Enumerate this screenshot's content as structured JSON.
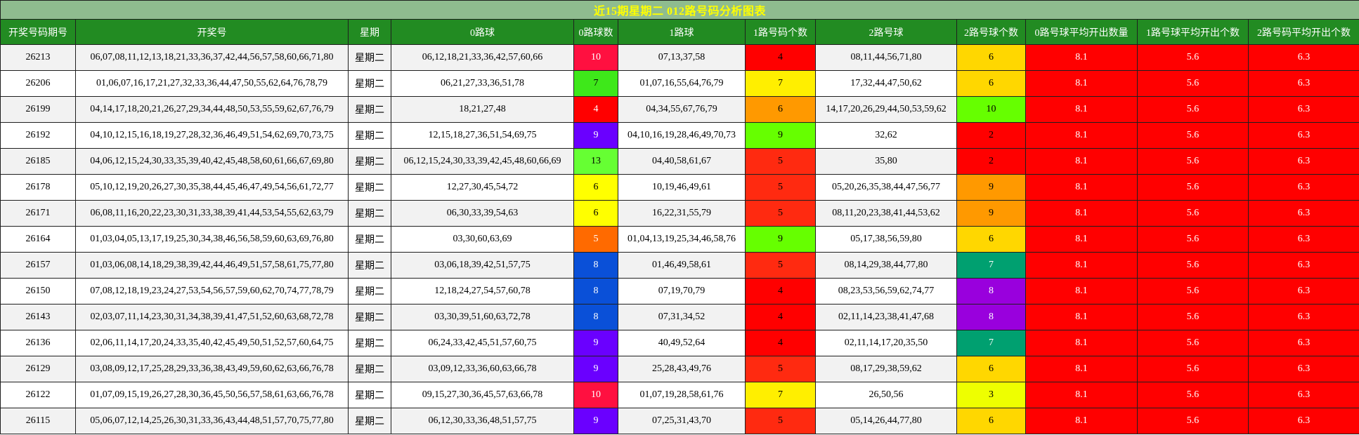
{
  "page_title": "近15期星期二 012路号码分析图表",
  "colors": {
    "title_bg": "#8fbc8f",
    "title_fg": "#ffff00",
    "header_bg": "#228b22",
    "header_fg": "#ffffff",
    "avg_bg": "#ff0000",
    "row_even_bg": "#f2f2f2",
    "row_odd_bg": "#ffffff"
  },
  "chart_data": {
    "type": "table",
    "title": "近15期星期二 012路号码分析图表",
    "columns": [
      "开奖号码期号",
      "开奖号",
      "星期",
      "0路球",
      "0路球数",
      "1路球",
      "1路号码个数",
      "2路号球",
      "2路号球个数",
      "0路号球平均开出数量",
      "1路号球平均开出个数",
      "2路号码平均开出个数"
    ],
    "rows": [
      {
        "issue": "26213",
        "numbers": "06,07,08,11,12,13,18,21,33,36,37,42,44,56,57,58,60,66,71,80",
        "weekday": "星期二",
        "r0": "06,12,18,21,33,36,42,57,60,66",
        "c0": "10",
        "r1": "07,13,37,58",
        "c1": "4",
        "r2": "08,11,44,56,71,80",
        "c2": "6",
        "a0": "8.1",
        "a1": "5.6",
        "a2": "6.3",
        "c0_color": "#ff1040",
        "c1_color": "#ff0000",
        "c2_color": "#ffd700"
      },
      {
        "issue": "26206",
        "numbers": "01,06,07,16,17,21,27,32,33,36,44,47,50,55,62,64,76,78,79",
        "weekday": "星期二",
        "r0": "06,21,27,33,36,51,78",
        "c0": "7",
        "r1": "01,07,16,55,64,76,79",
        "c1": "7",
        "r2": "17,32,44,47,50,62",
        "c2": "6",
        "a0": "8.1",
        "a1": "5.6",
        "a2": "6.3",
        "c0_color": "#3ee81a",
        "c1_color": "#ffef00",
        "c2_color": "#ffd700"
      },
      {
        "issue": "26199",
        "numbers": "04,14,17,18,20,21,26,27,29,34,44,48,50,53,55,59,62,67,76,79",
        "weekday": "星期二",
        "r0": "18,21,27,48",
        "c0": "4",
        "r1": "04,34,55,67,76,79",
        "c1": "6",
        "r2": "14,17,20,26,29,44,50,53,59,62",
        "c2": "10",
        "a0": "8.1",
        "a1": "5.6",
        "a2": "6.3",
        "c0_color": "#ff0000",
        "c1_color": "#ff9900",
        "c2_color": "#66ff00"
      },
      {
        "issue": "26192",
        "numbers": "04,10,12,15,16,18,19,27,28,32,36,46,49,51,54,62,69,70,73,75",
        "weekday": "星期二",
        "r0": "12,15,18,27,36,51,54,69,75",
        "c0": "9",
        "r1": "04,10,16,19,28,46,49,70,73",
        "c1": "9",
        "r2": "32,62",
        "c2": "2",
        "a0": "8.1",
        "a1": "5.6",
        "a2": "6.3",
        "c0_color": "#6a00ff",
        "c1_color": "#66ff00",
        "c2_color": "#ff0000"
      },
      {
        "issue": "26185",
        "numbers": "04,06,12,15,24,30,33,35,39,40,42,45,48,58,60,61,66,67,69,80",
        "weekday": "星期二",
        "r0": "06,12,15,24,30,33,39,42,45,48,60,66,69",
        "c0": "13",
        "r1": "04,40,58,61,67",
        "c1": "5",
        "r2": "35,80",
        "c2": "2",
        "a0": "8.1",
        "a1": "5.6",
        "a2": "6.3",
        "c0_color": "#66ff33",
        "c1_color": "#ff2a10",
        "c2_color": "#ff0000"
      },
      {
        "issue": "26178",
        "numbers": "05,10,12,19,20,26,27,30,35,38,44,45,46,47,49,54,56,61,72,77",
        "weekday": "星期二",
        "r0": "12,27,30,45,54,72",
        "c0": "6",
        "r1": "10,19,46,49,61",
        "c1": "5",
        "r2": "05,20,26,35,38,44,47,56,77",
        "c2": "9",
        "a0": "8.1",
        "a1": "5.6",
        "a2": "6.3",
        "c0_color": "#ffff00",
        "c1_color": "#ff2a10",
        "c2_color": "#ff9900"
      },
      {
        "issue": "26171",
        "numbers": "06,08,11,16,20,22,23,30,31,33,38,39,41,44,53,54,55,62,63,79",
        "weekday": "星期二",
        "r0": "06,30,33,39,54,63",
        "c0": "6",
        "r1": "16,22,31,55,79",
        "c1": "5",
        "r2": "08,11,20,23,38,41,44,53,62",
        "c2": "9",
        "a0": "8.1",
        "a1": "5.6",
        "a2": "6.3",
        "c0_color": "#ffff00",
        "c1_color": "#ff2a10",
        "c2_color": "#ff9900"
      },
      {
        "issue": "26164",
        "numbers": "01,03,04,05,13,17,19,25,30,34,38,46,56,58,59,60,63,69,76,80",
        "weekday": "星期二",
        "r0": "03,30,60,63,69",
        "c0": "5",
        "r1": "01,04,13,19,25,34,46,58,76",
        "c1": "9",
        "r2": "05,17,38,56,59,80",
        "c2": "6",
        "a0": "8.1",
        "a1": "5.6",
        "a2": "6.3",
        "c0_color": "#ff6a00",
        "c1_color": "#66ff00",
        "c2_color": "#ffd700"
      },
      {
        "issue": "26157",
        "numbers": "01,03,06,08,14,18,29,38,39,42,44,46,49,51,57,58,61,75,77,80",
        "weekday": "星期二",
        "r0": "03,06,18,39,42,51,57,75",
        "c0": "8",
        "r1": "01,46,49,58,61",
        "c1": "5",
        "r2": "08,14,29,38,44,77,80",
        "c2": "7",
        "a0": "8.1",
        "a1": "5.6",
        "a2": "6.3",
        "c0_color": "#0a50d8",
        "c1_color": "#ff2a10",
        "c2_color": "#00a070"
      },
      {
        "issue": "26150",
        "numbers": "07,08,12,18,19,23,24,27,53,54,56,57,59,60,62,70,74,77,78,79",
        "weekday": "星期二",
        "r0": "12,18,24,27,54,57,60,78",
        "c0": "8",
        "r1": "07,19,70,79",
        "c1": "4",
        "r2": "08,23,53,56,59,62,74,77",
        "c2": "8",
        "a0": "8.1",
        "a1": "5.6",
        "a2": "6.3",
        "c0_color": "#0a50d8",
        "c1_color": "#ff0000",
        "c2_color": "#9900dd"
      },
      {
        "issue": "26143",
        "numbers": "02,03,07,11,14,23,30,31,34,38,39,41,47,51,52,60,63,68,72,78",
        "weekday": "星期二",
        "r0": "03,30,39,51,60,63,72,78",
        "c0": "8",
        "r1": "07,31,34,52",
        "c1": "4",
        "r2": "02,11,14,23,38,41,47,68",
        "c2": "8",
        "a0": "8.1",
        "a1": "5.6",
        "a2": "6.3",
        "c0_color": "#0a50d8",
        "c1_color": "#ff0000",
        "c2_color": "#9900dd"
      },
      {
        "issue": "26136",
        "numbers": "02,06,11,14,17,20,24,33,35,40,42,45,49,50,51,52,57,60,64,75",
        "weekday": "星期二",
        "r0": "06,24,33,42,45,51,57,60,75",
        "c0": "9",
        "r1": "40,49,52,64",
        "c1": "4",
        "r2": "02,11,14,17,20,35,50",
        "c2": "7",
        "a0": "8.1",
        "a1": "5.6",
        "a2": "6.3",
        "c0_color": "#6a00ff",
        "c1_color": "#ff0000",
        "c2_color": "#00a070"
      },
      {
        "issue": "26129",
        "numbers": "03,08,09,12,17,25,28,29,33,36,38,43,49,59,60,62,63,66,76,78",
        "weekday": "星期二",
        "r0": "03,09,12,33,36,60,63,66,78",
        "c0": "9",
        "r1": "25,28,43,49,76",
        "c1": "5",
        "r2": "08,17,29,38,59,62",
        "c2": "6",
        "a0": "8.1",
        "a1": "5.6",
        "a2": "6.3",
        "c0_color": "#6a00ff",
        "c1_color": "#ff2a10",
        "c2_color": "#ffd700"
      },
      {
        "issue": "26122",
        "numbers": "01,07,09,15,19,26,27,28,30,36,45,50,56,57,58,61,63,66,76,78",
        "weekday": "星期二",
        "r0": "09,15,27,30,36,45,57,63,66,78",
        "c0": "10",
        "r1": "01,07,19,28,58,61,76",
        "c1": "7",
        "r2": "26,50,56",
        "c2": "3",
        "a0": "8.1",
        "a1": "5.6",
        "a2": "6.3",
        "c0_color": "#ff1040",
        "c1_color": "#ffef00",
        "c2_color": "#eeff00"
      },
      {
        "issue": "26115",
        "numbers": "05,06,07,12,14,25,26,30,31,33,36,43,44,48,51,57,70,75,77,80",
        "weekday": "星期二",
        "r0": "06,12,30,33,36,48,51,57,75",
        "c0": "9",
        "r1": "07,25,31,43,70",
        "c1": "5",
        "r2": "05,14,26,44,77,80",
        "c2": "6",
        "a0": "8.1",
        "a1": "5.6",
        "a2": "6.3",
        "c0_color": "#6a00ff",
        "c1_color": "#ff2a10",
        "c2_color": "#ffd700"
      }
    ]
  }
}
